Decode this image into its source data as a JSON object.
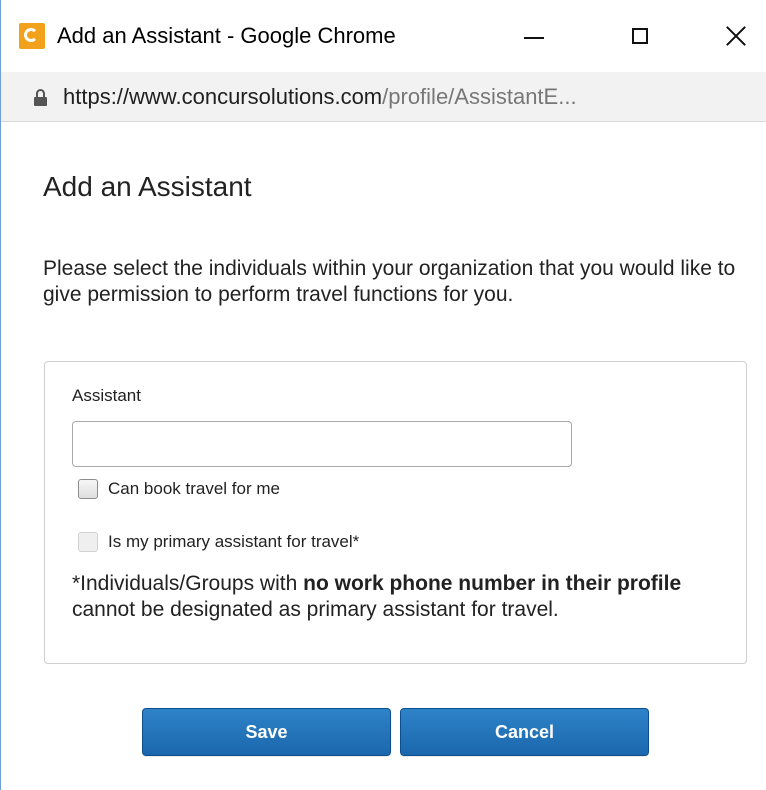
{
  "window": {
    "title": "Add an Assistant - Google Chrome",
    "icon": "concur-icon",
    "controls": {
      "minimize_icon": "minimize-icon",
      "maximize_icon": "maximize-icon",
      "close_icon": "close-icon"
    }
  },
  "address_bar": {
    "icon": "lock-icon",
    "url_host": "https://www.concursolutions.com",
    "url_path": "/profile/AssistantE..."
  },
  "page": {
    "title": "Add an Assistant",
    "intro": "Please select the individuals within your organization that you would like to give permission to perform travel functions for you.",
    "form": {
      "assistant_label": "Assistant",
      "assistant_value": "",
      "assistant_placeholder": "",
      "can_book_label": "Can book travel for me",
      "can_book_checked": false,
      "primary_label": "Is my primary assistant for travel*",
      "primary_checked": false,
      "primary_disabled": true,
      "note_prefix": "*Individuals/Groups with ",
      "note_bold": "no work phone number in their profile",
      "note_suffix": " cannot be designated as primary assistant for travel."
    },
    "buttons": {
      "save": "Save",
      "cancel": "Cancel"
    }
  },
  "colors": {
    "primary_button": "#1f6fb5",
    "window_border": "#6f9fd8",
    "app_icon": "#f1a21a"
  }
}
